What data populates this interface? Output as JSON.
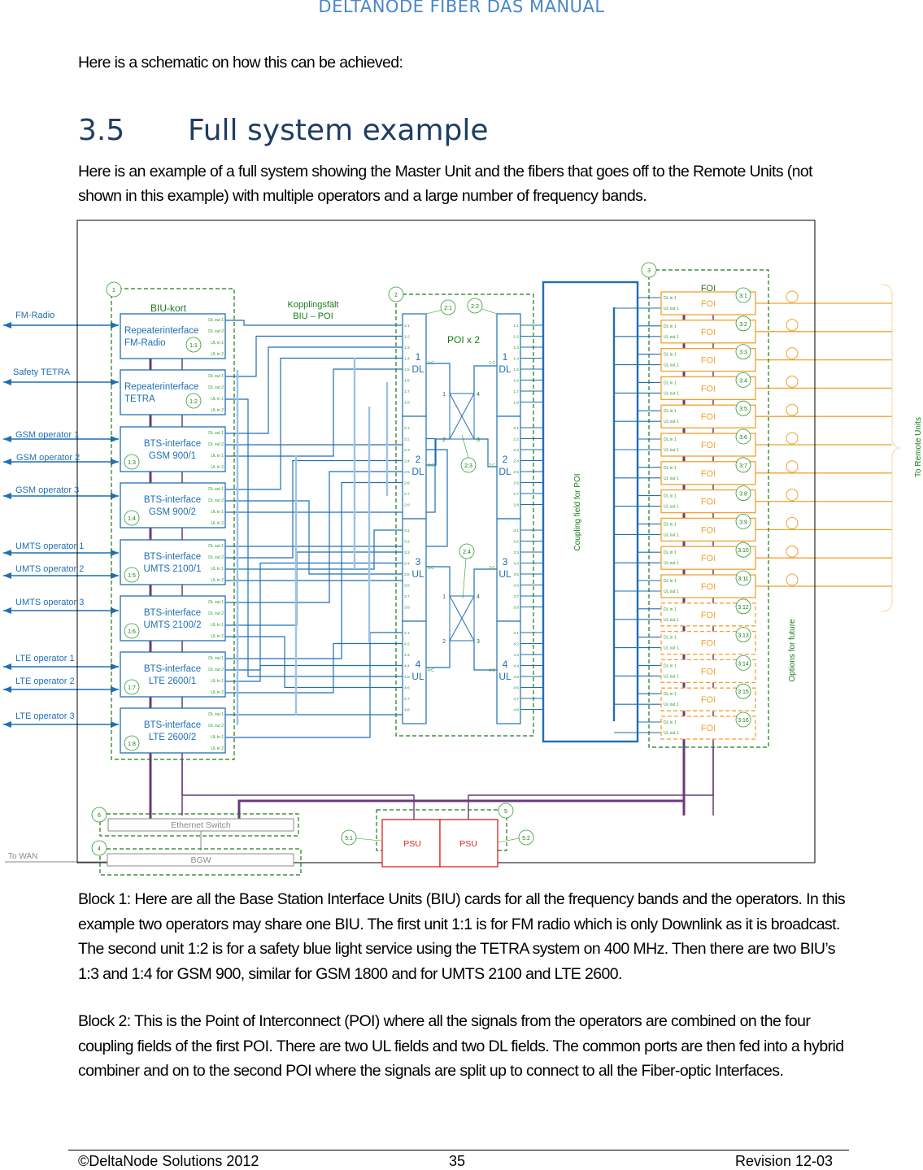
{
  "header": {
    "title": "DELTANODE FIBER DAS MANUAL"
  },
  "intro_text": "Here is a schematic on how this can be achieved:",
  "section": {
    "number": "3.5",
    "title": "Full system example"
  },
  "lead_text": "Here is an example of a full system showing the Master Unit and the fibers that goes off to the Remote Units (not shown in this example) with multiple operators and a large number of frequency bands.",
  "diagram": {
    "external_links": [
      "FM-Radio",
      "Safety TETRA",
      "GSM operator 1",
      "GSM operator 2",
      "GSM operator 3",
      "UMTS operator 1",
      "UMTS operator 2",
      "UMTS operator 3",
      "LTE operator 1",
      "LTE operator 2",
      "LTE operator 3"
    ],
    "block1": {
      "badge": "1",
      "title": "BIU-kort",
      "port_labels": [
        "DL out 1",
        "DL out 2",
        "UL in 1",
        "UL in 2"
      ],
      "cards": [
        {
          "line1": "Repeaterinterface",
          "line2": "FM-Radio",
          "badge": "1:1"
        },
        {
          "line1": "Repeaterinterface",
          "line2": "TETRA",
          "badge": "1:2"
        },
        {
          "line1": "BTS-interface",
          "line2": "GSM 900/1",
          "badge": "1:3"
        },
        {
          "line1": "BTS-interface",
          "line2": "GSM 900/2",
          "badge": "1:4"
        },
        {
          "line1": "BTS-interface",
          "line2": "UMTS 2100/1",
          "badge": "1:5"
        },
        {
          "line1": "BTS-interface",
          "line2": "UMTS 2100/2",
          "badge": "1:6"
        },
        {
          "line1": "BTS-interface",
          "line2": "LTE 2600/1",
          "badge": "1:7"
        },
        {
          "line1": "BTS-interface",
          "line2": "LTE 2600/2",
          "badge": "1:8"
        }
      ]
    },
    "coupling_label": [
      "Kopplingsfält",
      "BIU – POI"
    ],
    "block2": {
      "badge": "2",
      "title": "POI x 2",
      "poi_badges": [
        "2:1",
        "2:2"
      ],
      "hybrid_badges": [
        "2:3",
        "2:4"
      ],
      "fields": [
        {
          "num": "1",
          "type": "DL",
          "common": "1:C"
        },
        {
          "num": "2",
          "type": "DL",
          "common": "2:C"
        },
        {
          "num": "3",
          "type": "UL",
          "common": "3:C"
        },
        {
          "num": "4",
          "type": "UL",
          "common": "4:C"
        }
      ],
      "hybrid_ports": [
        "1",
        "2",
        "3",
        "4"
      ]
    },
    "coupling_field_poi": "Coupling field for POI",
    "block3": {
      "badge": "3",
      "title": "FOI",
      "unit_label": "FOI",
      "port_labels": [
        "DL in 1",
        "UL out 1"
      ],
      "units": [
        "3:1",
        "3:2",
        "3:3",
        "3:4",
        "3:5",
        "3:6",
        "3:7",
        "3:8",
        "3:9",
        "3:10",
        "3:11",
        "3:12",
        "3:13",
        "3:14",
        "3:15",
        "3:16"
      ],
      "installed_count": 11,
      "options_label": "Options for future"
    },
    "to_remote_units": "To Remote Units",
    "block4": {
      "badge": "4",
      "label": "BGW"
    },
    "block5": {
      "badge": "5",
      "psu_labels": [
        "PSU",
        "PSU"
      ],
      "psu_badges": [
        "5:1",
        "5:2"
      ]
    },
    "block6": {
      "badge": "6",
      "label": "Ethernet Switch"
    },
    "to_wan": "To WAN",
    "colors": {
      "blue": "#1f6fb5",
      "light_blue": "#9dc3e6",
      "green": "#2e9a2e",
      "dark_green": "#1a7a1a",
      "orange": "#f2a12e",
      "purple": "#6b3a7a",
      "red": "#e02020",
      "gray": "#888888"
    }
  },
  "block1_text": "Block 1: Here are all the Base Station Interface Units (BIU) cards for all the frequency bands and the operators. In this example two operators may share one BIU. The first unit 1:1 is for FM radio which is only Downlink as it is broadcast. The second unit 1:2 is for a safety blue light service using the TETRA system on 400 MHz. Then there are two BIU’s 1:3 and 1:4 for GSM 900, similar for GSM 1800 and for UMTS 2100 and LTE 2600.",
  "block2_text": "Block 2: This is the Point of Interconnect (POI) where all the signals from the operators are combined on the four coupling fields of the first POI. There are two UL fields and two DL fields. The common ports are then fed into a hybrid combiner and on to the second POI where the signals are split up to connect to all the Fiber-optic Interfaces.",
  "footer": {
    "copyright": "©DeltaNode Solutions 2012",
    "page": "35",
    "revision": "Revision 12-03"
  }
}
